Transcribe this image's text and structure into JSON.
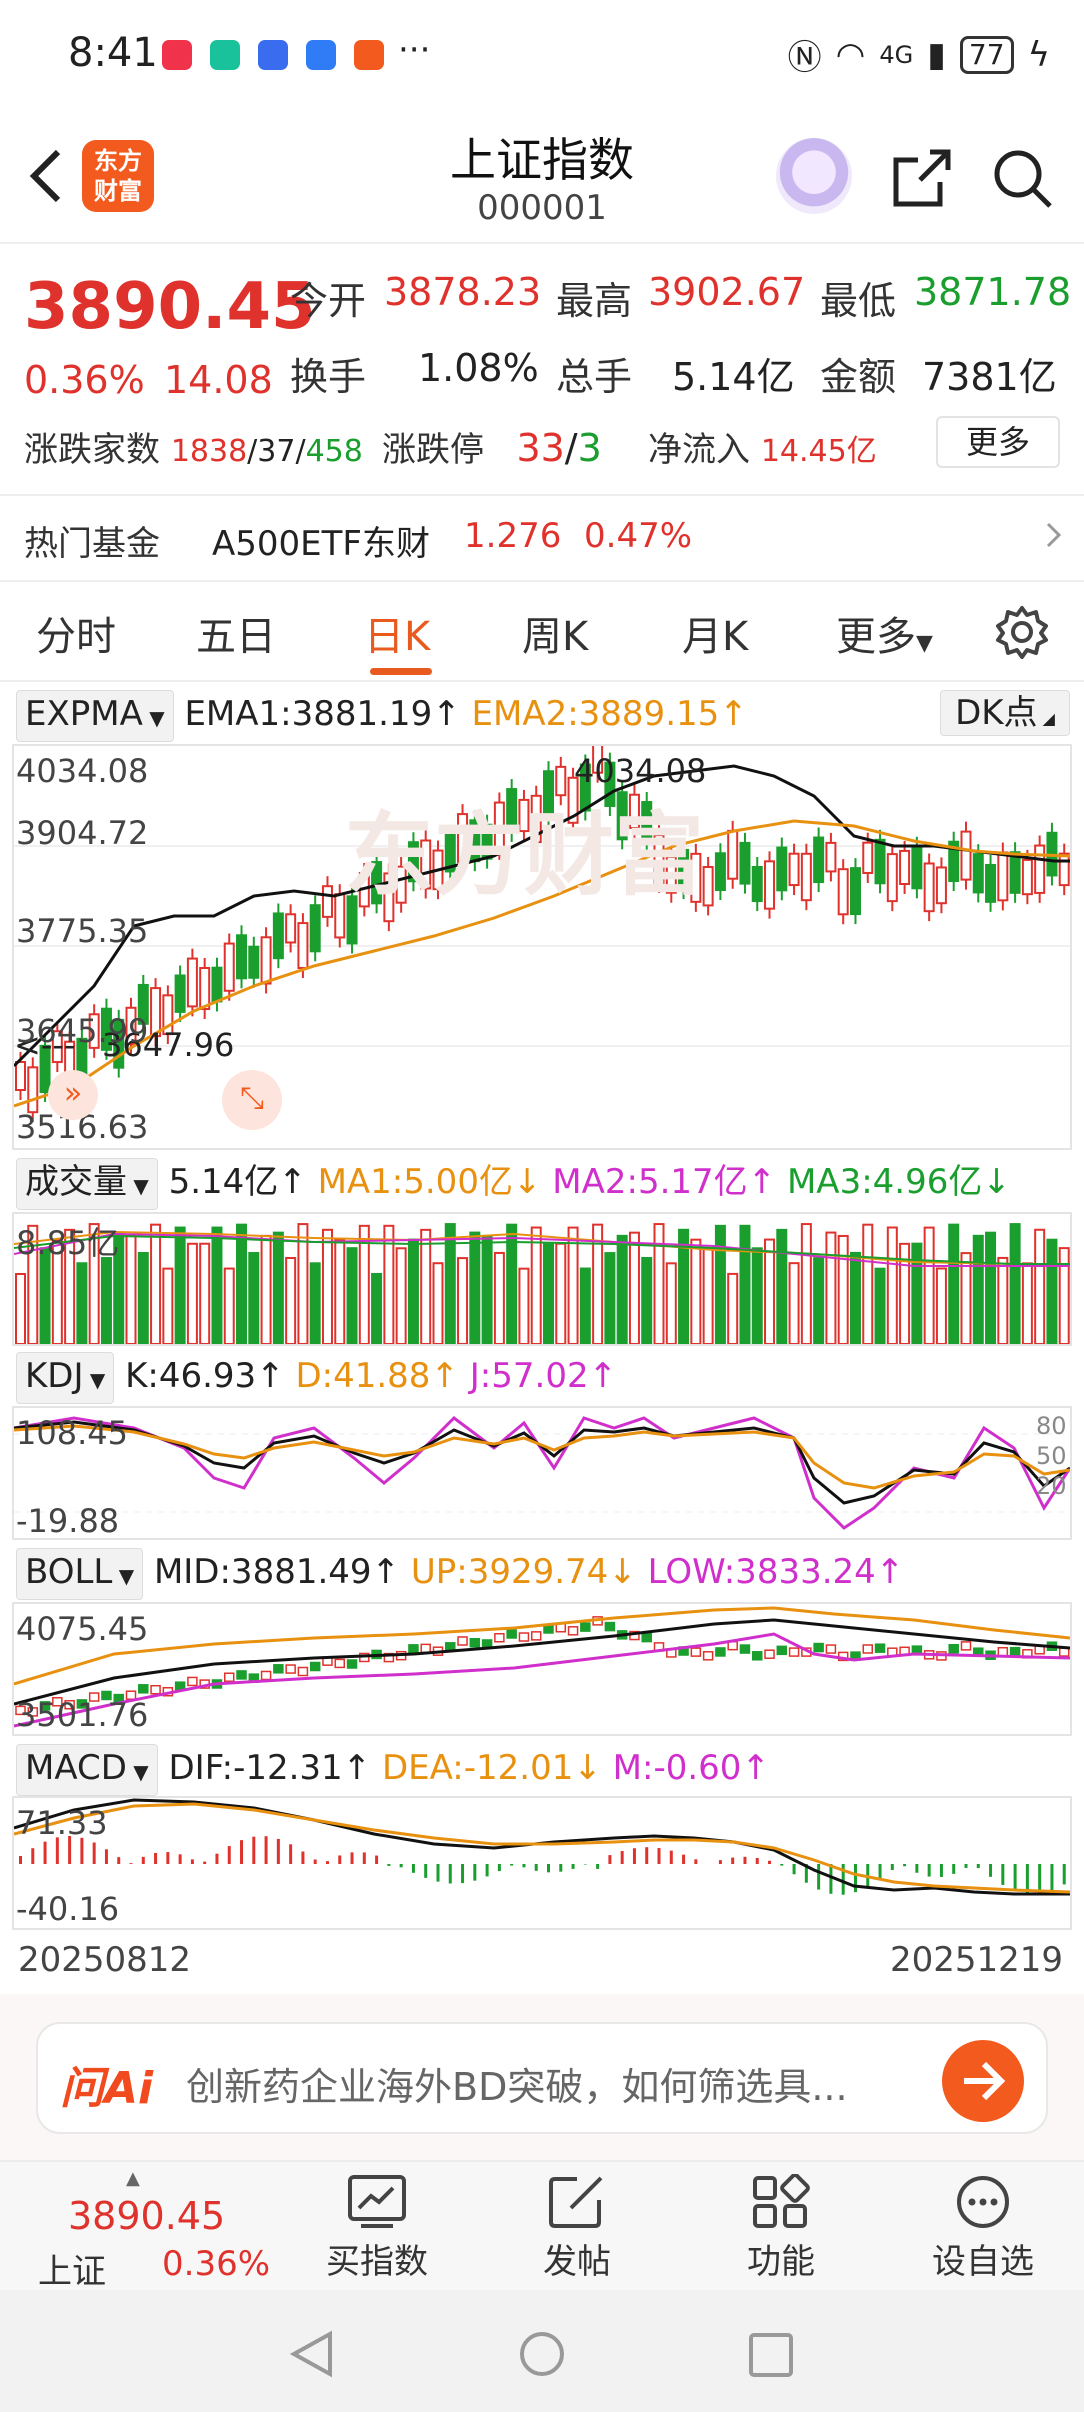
{
  "status": {
    "time": "8:41",
    "more": "···",
    "signal": "4G",
    "battery": "77"
  },
  "header": {
    "logo_line1": "东方",
    "logo_line2": "财富",
    "title": "上证指数",
    "code": "000001"
  },
  "quote": {
    "price": "3890.45",
    "change_pct": "0.36%",
    "change": "14.08",
    "open_label": "今开",
    "open": "3878.23",
    "high_label": "最高",
    "high": "3902.67",
    "low_label": "最低",
    "low": "3871.78",
    "turnover_label": "换手",
    "turnover": "1.08%",
    "volume_label": "总手",
    "volume": "5.14亿",
    "amount_label": "金额",
    "amount": "7381亿",
    "breadth_label": "涨跌家数",
    "breadth_up": "1838",
    "breadth_flat": "37",
    "breadth_down": "458",
    "limit_label": "涨跌停",
    "limit_up": "33",
    "limit_down": "3",
    "inflow_label": "净流入",
    "inflow": "14.45亿",
    "more_button": "更多"
  },
  "hot_fund": {
    "label": "热门基金",
    "name": "A500ETF东财",
    "price": "1.276",
    "pct": "0.47%"
  },
  "tabs": [
    "分时",
    "五日",
    "日K",
    "周K",
    "月K",
    "更多"
  ],
  "active_tab": "日K",
  "colors": {
    "up": "#e0322c",
    "down": "#1a9e2e",
    "accent": "#e85a1e",
    "ema2": "#e8900f",
    "magenta": "#d02fcc"
  },
  "kline": {
    "selector": "EXPMA",
    "ema1": "EMA1:3881.19",
    "ema2": "EMA2:3889.15",
    "dk_button": "DK点",
    "y_max": "4034.08",
    "y_2": "3904.72",
    "y_3": "3775.35",
    "y_4": "3645.99",
    "y_min": "3516.63",
    "peak_label": "4034.08",
    "trough_label": "3647.96",
    "watermark": "东方财富"
  },
  "volume": {
    "selector": "成交量",
    "value": "5.14亿",
    "ma1": "MA1:5.00亿",
    "ma2": "MA2:5.17亿",
    "ma3": "MA3:4.96亿",
    "y_max": "8.85亿"
  },
  "kdj": {
    "selector": "KDJ",
    "k": "K:46.93",
    "d": "D:41.88",
    "j": "J:57.02",
    "y_max": "108.45",
    "y_min": "-19.88",
    "r80": "80",
    "r50": "50",
    "r20": "20"
  },
  "boll": {
    "selector": "BOLL",
    "mid": "MID:3881.49",
    "up": "UP:3929.74",
    "low": "LOW:3833.24",
    "y_max": "4075.45",
    "y_min": "3501.76"
  },
  "macd": {
    "selector": "MACD",
    "dif": "DIF:-12.31",
    "dea": "DEA:-12.01",
    "m": "M:-0.60",
    "y_max": "71.33",
    "y_min": "-40.16"
  },
  "date_start": "20250812",
  "date_end": "20251219",
  "ai": {
    "brand": "问Ai",
    "prompt": "创新药企业海外BD突破，如何筛选具..."
  },
  "bottom": {
    "index_price": "3890.45",
    "index_name": "上证",
    "index_pct": "0.36%",
    "buy": "买指数",
    "post": "发帖",
    "func": "功能",
    "watch": "设自选"
  }
}
